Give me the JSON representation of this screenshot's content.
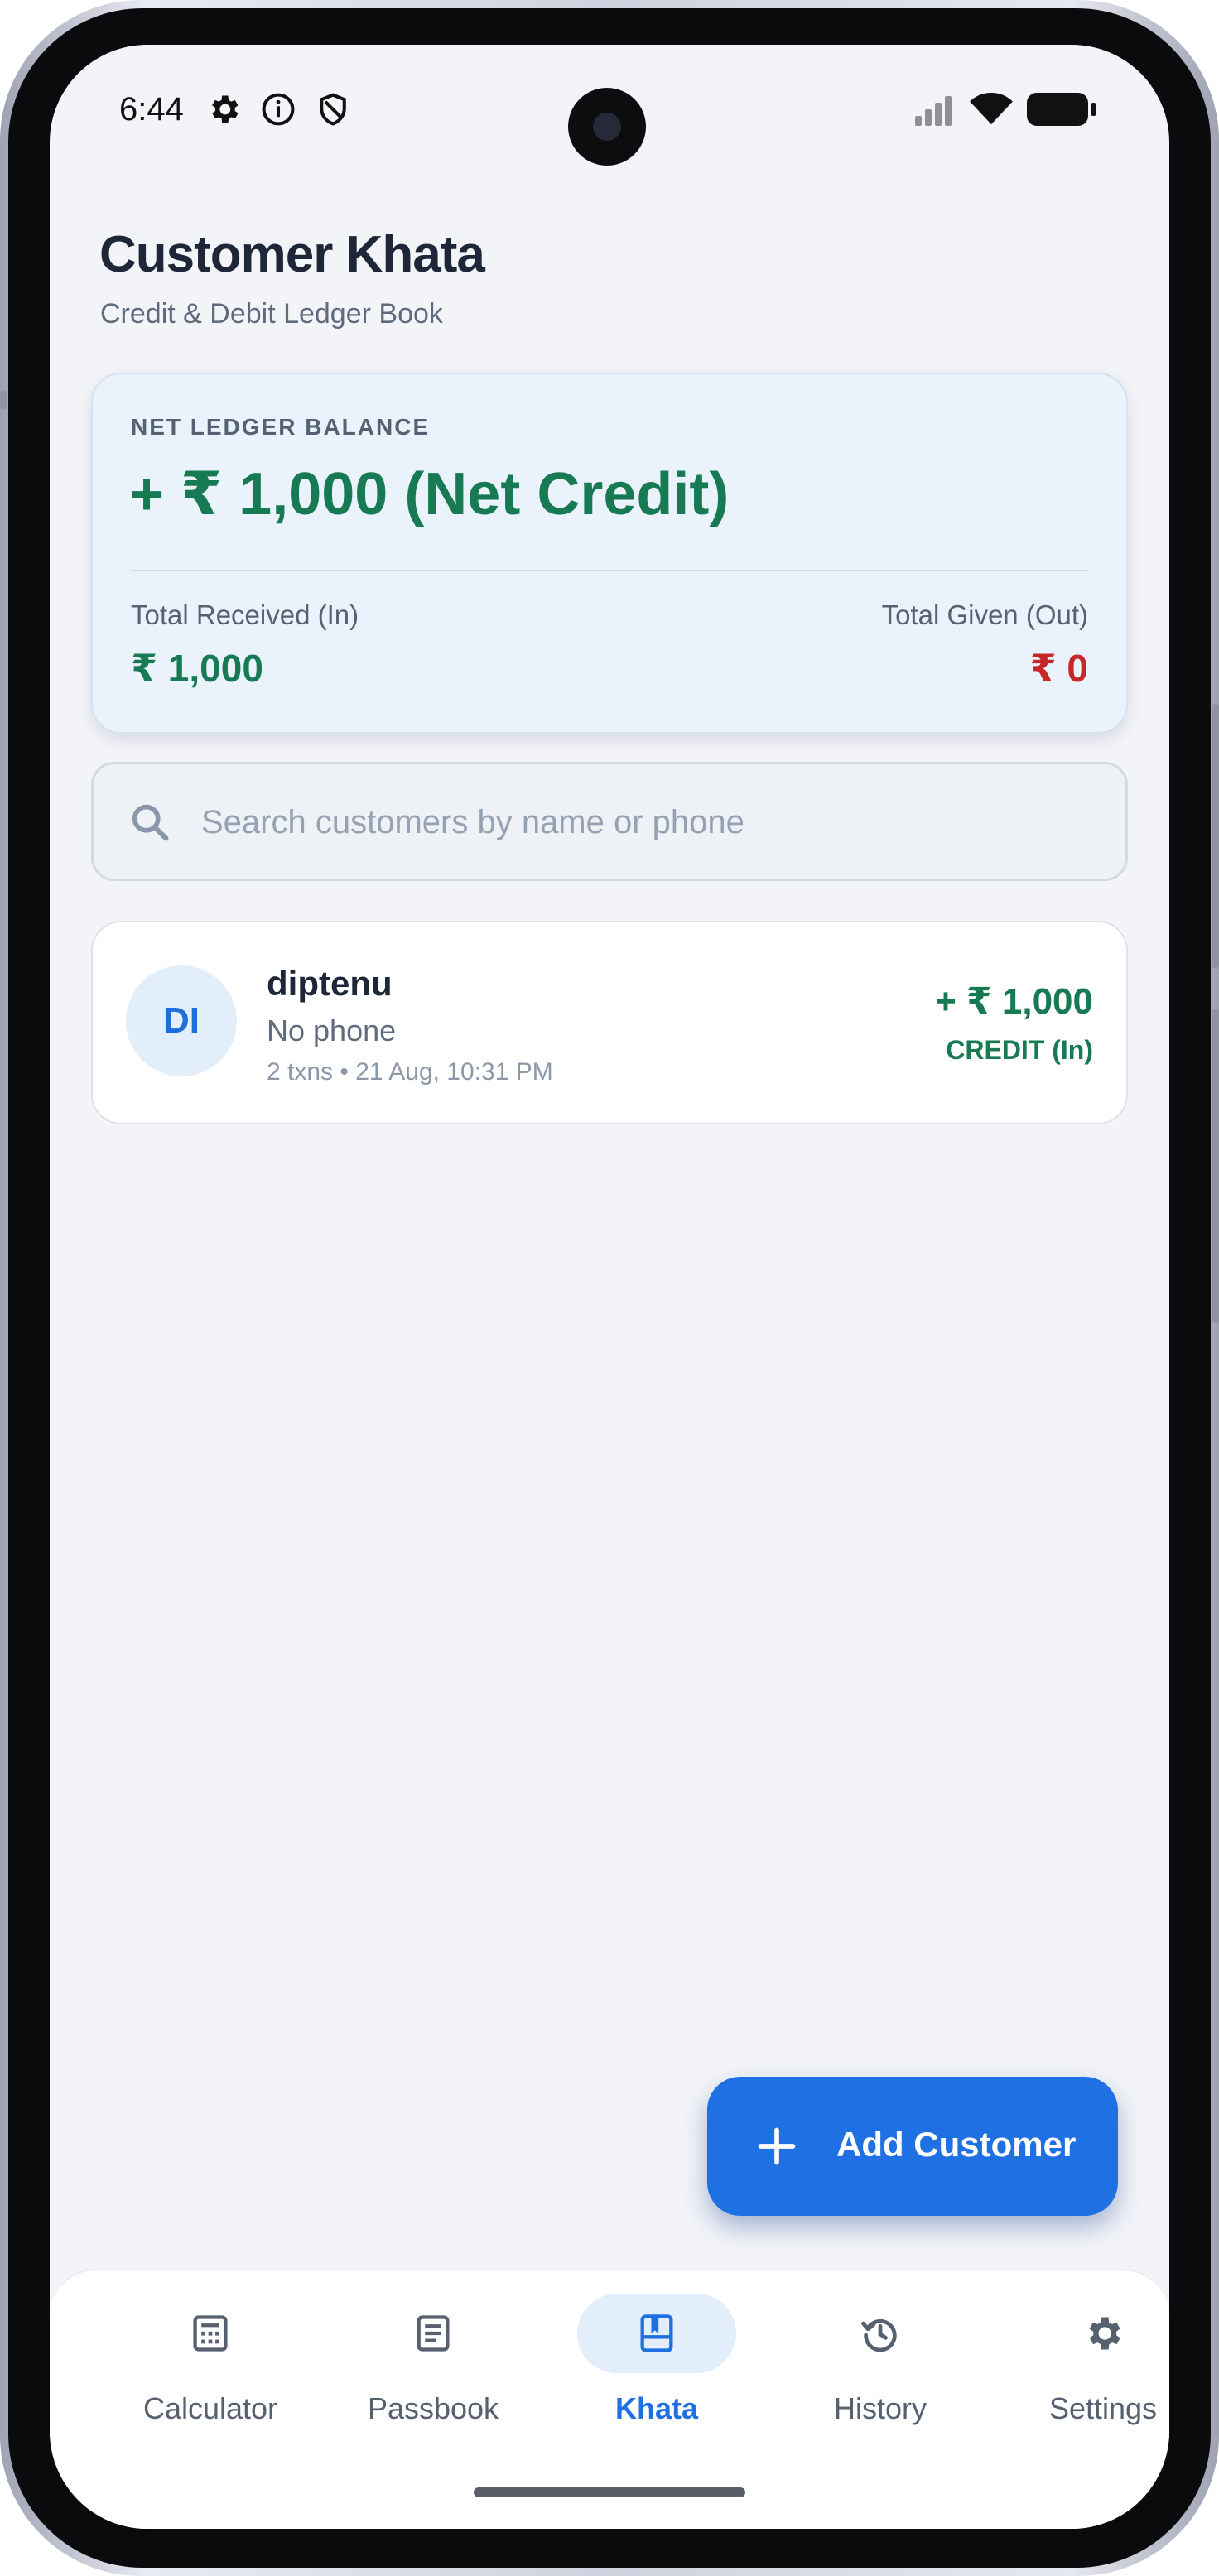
{
  "status_bar": {
    "time": "6:44",
    "left_icons": [
      "gear-icon",
      "info-icon",
      "shield-icon"
    ],
    "right_icons": [
      "signal-icon",
      "wifi-icon",
      "battery-icon"
    ]
  },
  "header": {
    "title": "Customer Khata",
    "subtitle": "Credit & Debit Ledger Book"
  },
  "balance": {
    "label": "NET LEDGER BALANCE",
    "value": "+ ₹ 1,000 (Net Credit)",
    "received_label": "Total Received (In)",
    "received_value": "₹ 1,000",
    "given_label": "Total Given (Out)",
    "given_value": "₹ 0"
  },
  "search": {
    "placeholder": "Search customers by name or phone",
    "value": ""
  },
  "customers": [
    {
      "initials": "DI",
      "name": "diptenu",
      "phone": "No phone",
      "meta": "2 txns • 21 Aug, 10:31 PM",
      "amount": "+ ₹ 1,000",
      "status": "CREDIT (In)"
    }
  ],
  "fab": {
    "label": "Add Customer",
    "icon": "plus-icon"
  },
  "nav": {
    "items": [
      {
        "label": "Calculator",
        "icon": "calculator-icon",
        "active": false
      },
      {
        "label": "Passbook",
        "icon": "passbook-icon",
        "active": false
      },
      {
        "label": "Khata",
        "icon": "khata-icon",
        "active": true
      },
      {
        "label": "History",
        "icon": "history-icon",
        "active": false
      },
      {
        "label": "Settings",
        "icon": "settings-icon",
        "active": false
      }
    ]
  },
  "colors": {
    "credit": "#177a52",
    "debit": "#c62828",
    "accent": "#1f70e2",
    "background": "#f2f4f8"
  }
}
